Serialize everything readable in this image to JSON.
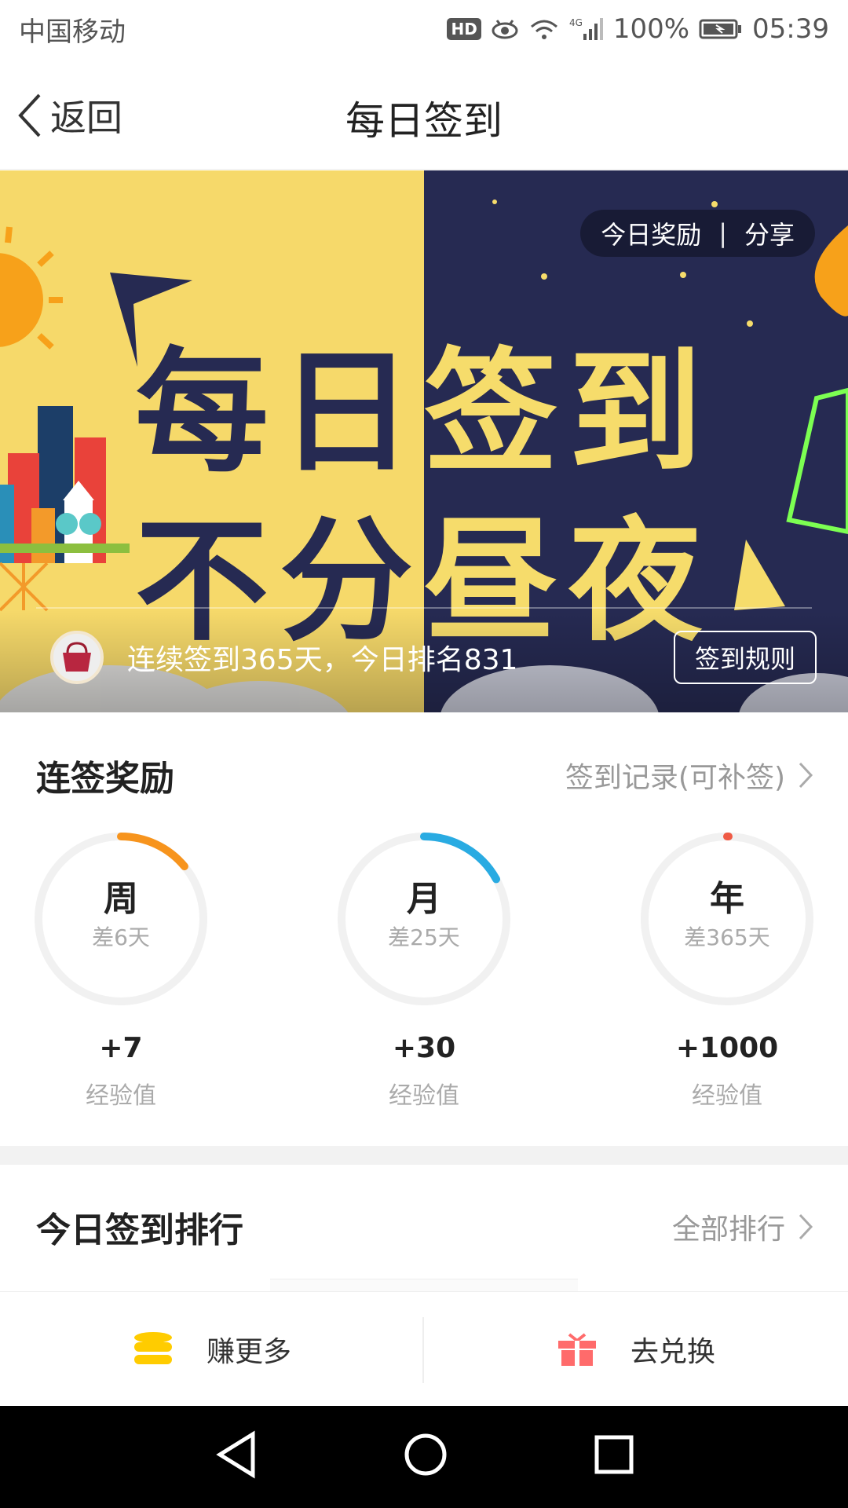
{
  "status_bar": {
    "carrier": "中国移动",
    "hd": "HD",
    "network": "4G",
    "battery": "100%",
    "time": "05:39"
  },
  "nav": {
    "back_label": "返回",
    "title": "每日签到"
  },
  "banner": {
    "line1_left": "每日",
    "line1_right": "签到",
    "line2_left": "不分",
    "line2_right": "昼夜",
    "today_reward": "今日奖励",
    "pill_separator": "|",
    "share": "分享",
    "streak_text": "连续签到365天，今日排名831",
    "rules_button": "签到规则",
    "colors": {
      "day": "#f6d96a",
      "night": "#262a52"
    }
  },
  "rewards": {
    "title": "连签奖励",
    "record_link": "签到记录(可补签)",
    "items": [
      {
        "label": "周",
        "remaining": "差6天",
        "bonus": "+7",
        "unit": "经验值",
        "progress": 0.14,
        "color": "#f7941d"
      },
      {
        "label": "月",
        "remaining": "差25天",
        "bonus": "+30",
        "unit": "经验值",
        "progress": 0.17,
        "color": "#29abe2"
      },
      {
        "label": "年",
        "remaining": "差365天",
        "bonus": "+1000",
        "unit": "经验值",
        "progress": 0.0,
        "color": "#ef5a45"
      }
    ]
  },
  "ranking": {
    "title": "今日签到排行",
    "all_link": "全部排行"
  },
  "actions": {
    "earn_more": "赚更多",
    "redeem": "去兑换"
  }
}
